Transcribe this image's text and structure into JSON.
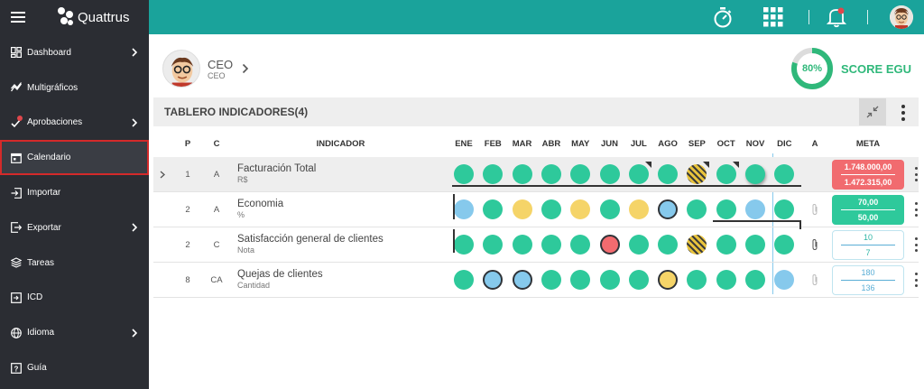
{
  "app": {
    "name": "Quattrus"
  },
  "sidebar": {
    "items": [
      {
        "label": "Dashboard",
        "icon": "dashboard-icon",
        "chevron": true
      },
      {
        "label": "Multigráficos",
        "icon": "chart-line-icon",
        "chevron": false
      },
      {
        "label": "Aprobaciones",
        "icon": "approval-icon",
        "chevron": true,
        "badge": true
      },
      {
        "label": "Calendario",
        "icon": "calendar-icon",
        "chevron": false,
        "active": true
      },
      {
        "label": "Importar",
        "icon": "import-icon",
        "chevron": false
      },
      {
        "label": "Exportar",
        "icon": "export-icon",
        "chevron": true
      },
      {
        "label": "Tareas",
        "icon": "layers-icon",
        "chevron": false
      },
      {
        "label": "ICD",
        "icon": "icd-icon",
        "chevron": false
      },
      {
        "label": "Idioma",
        "icon": "globe-icon",
        "chevron": true
      },
      {
        "label": "Guía",
        "icon": "guide-icon",
        "chevron": false
      }
    ]
  },
  "topbar": {
    "icons": [
      "stopwatch-icon",
      "apps-grid-icon",
      "bell-icon",
      "user-avatar-icon"
    ],
    "notification_badge": "!"
  },
  "profile": {
    "name": "CEO",
    "role": "CEO"
  },
  "score": {
    "percent_label": "80%",
    "percent": 80,
    "label": "SCORE EGU"
  },
  "panel": {
    "title": "TABLERO INDICADORES(4)"
  },
  "table": {
    "headers": {
      "p": "P",
      "c": "C",
      "indicator": "INDICADOR",
      "a": "A",
      "meta": "META",
      "months": [
        "ENE",
        "FEB",
        "MAR",
        "ABR",
        "MAY",
        "JUN",
        "JUL",
        "AGO",
        "SEP",
        "OCT",
        "NOV",
        "DIC"
      ]
    },
    "rows": [
      {
        "p": "1",
        "c": "A",
        "name": "Facturación Total",
        "unit": "R$",
        "months": [
          "green",
          "green",
          "green",
          "green",
          "green",
          "green",
          "green-flag",
          "green",
          "hatch-flag",
          "green-flag",
          "green-shadow",
          "green"
        ],
        "meta_top": "1.748.000,00",
        "meta_bottom": "1.472.315,00",
        "meta_style": "red"
      },
      {
        "p": "2",
        "c": "A",
        "name": "Economia",
        "unit": "%",
        "months": [
          "blue",
          "green",
          "yellow",
          "green",
          "yellow",
          "green",
          "yellow",
          "blue-ring",
          "green",
          "green",
          "blue",
          "green"
        ],
        "meta_top": "70,00",
        "meta_bottom": "50,00",
        "meta_style": "green"
      },
      {
        "p": "2",
        "c": "C",
        "name": "Satisfacción general de clientes",
        "unit": "Nota",
        "months": [
          "green",
          "green",
          "green",
          "green",
          "green",
          "red-ring",
          "green",
          "green",
          "hatch",
          "green",
          "green",
          "green"
        ],
        "meta_top": "10",
        "meta_bottom": "7",
        "meta_style": "outline"
      },
      {
        "p": "8",
        "c": "CA",
        "name": "Quejas de clientes",
        "unit": "Cantidad",
        "months": [
          "green",
          "blue-ring",
          "blue-ring",
          "green",
          "green",
          "green",
          "green",
          "yellow-ring",
          "green",
          "green",
          "green",
          "blue"
        ],
        "meta_top": "180",
        "meta_bottom": "136",
        "meta_style": "outline-blue"
      }
    ]
  },
  "colors": {
    "topbar": "#1aa39b",
    "sidebar": "#2b2d33",
    "green": "#2ec99b",
    "blue": "#86c9ec",
    "yellow": "#f5d468",
    "red": "#f36b6f",
    "active_outline": "#d42a2a"
  }
}
